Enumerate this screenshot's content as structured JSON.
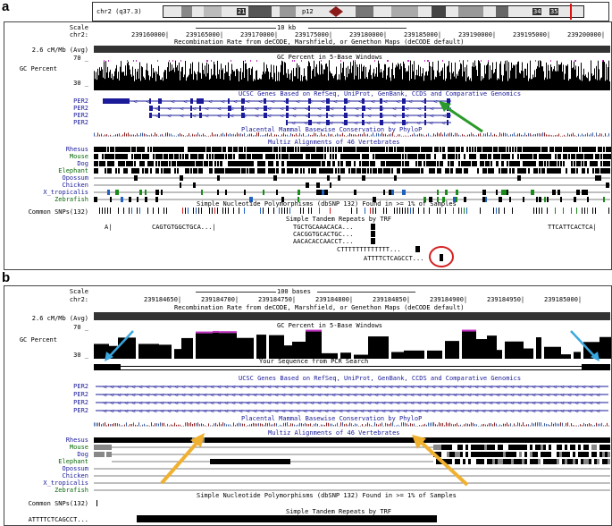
{
  "panel_a": {
    "letter": "a",
    "ideogram": {
      "chrom": "chr2 (q37.3)",
      "bands": [
        "21",
        "p12",
        "34",
        "35"
      ]
    },
    "scale_label": "Scale",
    "scale_value": "10 kb",
    "chrom_label": "chr2:",
    "positions": [
      "239160000|",
      "239165000|",
      "239170000|",
      "239175000|",
      "239180000|",
      "239185000|",
      "239190000|",
      "239195000|",
      "239200000|"
    ],
    "recomb_label": "2.6 cM/Mb (Avg)",
    "recomb_title": "Recombination Rate from deCODE, Marshfield, or Genethon Maps (deCODE default)",
    "gc_title": "GC Percent in 5-Base Windows",
    "gc_label": "GC Percent",
    "gc_max": "70 _",
    "gc_min": "30 _",
    "genes_title": "UCSC Genes Based on RefSeq, UniProt, GenBank, CCDS and Comparative Genomics",
    "genes": [
      "PER2",
      "PER2",
      "PER2",
      "PER2"
    ],
    "cons_title": "Placental Mammal Basewise Conservation by PhyloP",
    "multiz_title": "Multiz Alignments of 46 Vertebrates",
    "species": [
      "Rhesus",
      "Mouse",
      "Dog",
      "Elephant",
      "Opossum",
      "Chicken",
      "X_tropicalis",
      "Zebrafish"
    ],
    "snp_title": "Simple Nucleotide Polymorphisms (dbSNP 132) Found in >= 1% of Samples",
    "snp_label": "Common SNPs(132)",
    "repeats_title": "Simple Tandem Repeats by TRF",
    "repeats": [
      "A|",
      "CAGTGTGGCTGCA...|",
      "TGCTGCAAACACA...",
      "CACGGTGCACTGC...",
      "AACACACCAACCT...",
      "CTTTTTTTTTTTTT...",
      "ATTTTCTCAGCCT...",
      "TTCATTCACTCA|"
    ]
  },
  "panel_b": {
    "letter": "b",
    "scale_label": "Scale",
    "scale_value": "100 bases",
    "chrom_label": "chr2:",
    "positions": [
      "239184650|",
      "239184700|",
      "239184750|",
      "239184800|",
      "239184850|",
      "239184900|",
      "239184950|",
      "239185000|"
    ],
    "recomb_label": "2.6 cM/Mb (Avg)",
    "recomb_title": "Recombination Rate from deCODE, Marshfield, or Genethon Maps (deCODE default)",
    "gc_title": "GC Percent in 5-Base Windows",
    "gc_label": "GC Percent",
    "gc_max": "70 _",
    "gc_min": "30 _",
    "pcr_title": "Your Sequence from PCR Search",
    "genes_title": "UCSC Genes Based on RefSeq, UniProt, GenBank, CCDS and Comparative Genomics",
    "genes": [
      "PER2",
      "PER2",
      "PER2",
      "PER2"
    ],
    "cons_title": "Placental Mammal Basewise Conservation by PhyloP",
    "multiz_title": "Multiz Alignments of 46 Vertebrates",
    "species": [
      "Rhesus",
      "Mouse",
      "Dog",
      "Elephant",
      "Opossum",
      "Chicken",
      "X_tropicalis",
      "Zebrafish"
    ],
    "snp_title": "Simple Nucleotide Polymorphisms (dbSNP 132) Found in >= 1% of Samples",
    "snp_label": "Common SNPs(132)",
    "repeats_title": "Simple Tandem Repeats by TRF",
    "repeat_label": "ATTTTCTCAGCCT..."
  },
  "colors": {
    "gene_blue": "#1b1b9a",
    "green_arrow": "#2a9a2a",
    "orange_arrow": "#f0b030",
    "cyan_arrow": "#3aa8e0",
    "red_circle": "#d42020",
    "gc_high": "#c030c0"
  }
}
